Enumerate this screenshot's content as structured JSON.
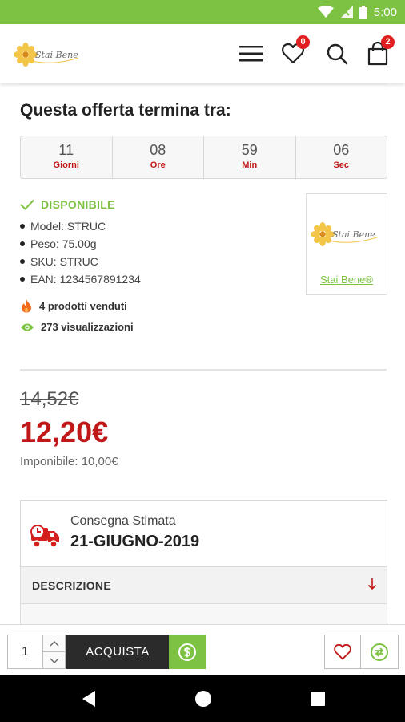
{
  "status_bar": {
    "time": "5:00",
    "icons": [
      "wifi-icon",
      "signal-icon",
      "battery-icon"
    ],
    "color": "#7dc242"
  },
  "header": {
    "logo_text": "Stai Bene",
    "wishlist_count": "0",
    "cart_count": "2",
    "icons": [
      "menu-icon",
      "heart-icon",
      "search-icon",
      "shopping-bag-icon"
    ]
  },
  "offer": {
    "title": "Questa offerta termina tra:",
    "countdown": [
      {
        "value": "11",
        "label": "Giorni"
      },
      {
        "value": "08",
        "label": "Ore"
      },
      {
        "value": "59",
        "label": "Min"
      },
      {
        "value": "06",
        "label": "Sec"
      }
    ]
  },
  "product": {
    "availability": "DISPONIBILE",
    "specs": [
      "Model: STRUC",
      "Peso: 75.00g",
      "SKU: STRUC",
      "EAN: 1234567891234"
    ],
    "sold": "4 prodotti venduti",
    "views": "273 visualizzazioni",
    "brand": {
      "logo_text": "Stai Bene",
      "link_label": "Stai Bene®"
    }
  },
  "pricing": {
    "old_price": "14,52€",
    "new_price": "12,20€",
    "taxable": "Imponibile: 10,00€"
  },
  "delivery": {
    "label": "Consegna Stimata",
    "date": "21-GIUGNO-2019"
  },
  "description": {
    "label": "DESCRIZIONE"
  },
  "action_bar": {
    "quantity": "1",
    "buy_label": "ACQUISTA"
  },
  "colors": {
    "accent_green": "#7dc242",
    "price_red": "#c01818",
    "dark_button": "#2b2b2b"
  }
}
